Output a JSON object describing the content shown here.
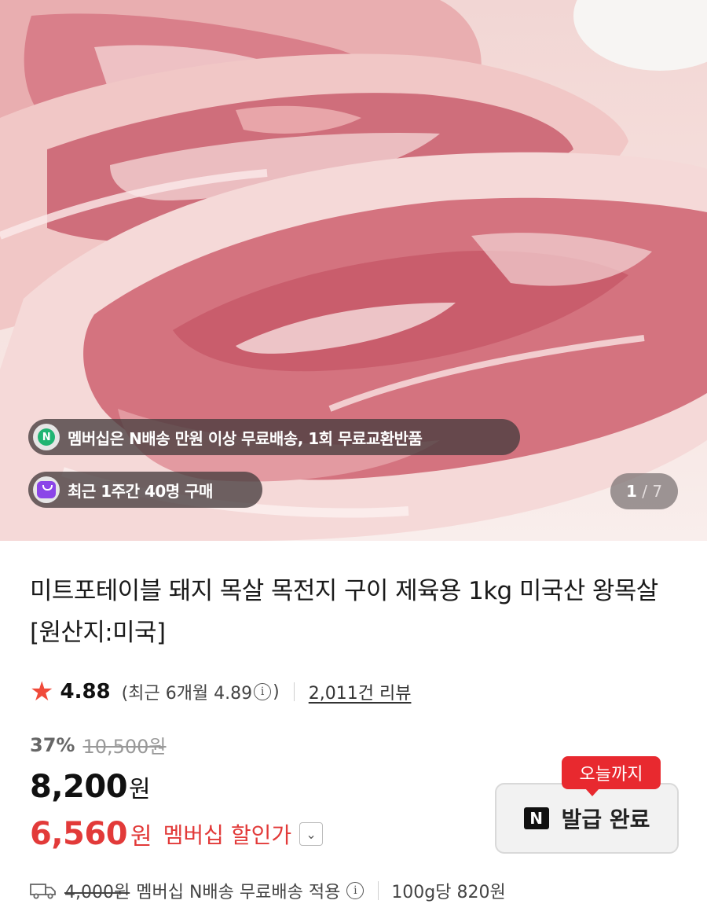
{
  "hero": {
    "image_alt": "돼지 목살",
    "membership_banner": "멤버십은 N배송 만원 이상 무료배송, 1회 무료교환반품",
    "recent_buyers": "최근 1주간 40명 구매",
    "image_index": "1",
    "image_total": "7",
    "badge_n": "N"
  },
  "product": {
    "title": "미트포테이블 돼지 목살 목전지 구이 제육용 1kg 미국산 왕목살 [원산지:미국]",
    "rating": "4.88",
    "recent_rating_prefix": "(최근 6개월 4.89",
    "recent_rating_suffix": ")",
    "info_glyph": "i",
    "reviews": "2,011건 리뷰",
    "discount_pct": "37%",
    "original_price": "10,500원",
    "price": "8,200",
    "price_unit": "원",
    "member_price": "6,560",
    "member_price_unit": "원",
    "member_label": "멤버십 할인가"
  },
  "coupon": {
    "tag": "오늘까지",
    "n_mark": "N",
    "label": "발급 완료"
  },
  "shipping": {
    "original_fee": "4,000원",
    "note": "멤버십 N배송 무료배송 적용",
    "unit_price": "100g당 820원"
  },
  "colors": {
    "accent_red": "#e23a39",
    "star": "#f04a3a",
    "n_green": "#20b573",
    "bag_purple": "#8b45e8"
  }
}
